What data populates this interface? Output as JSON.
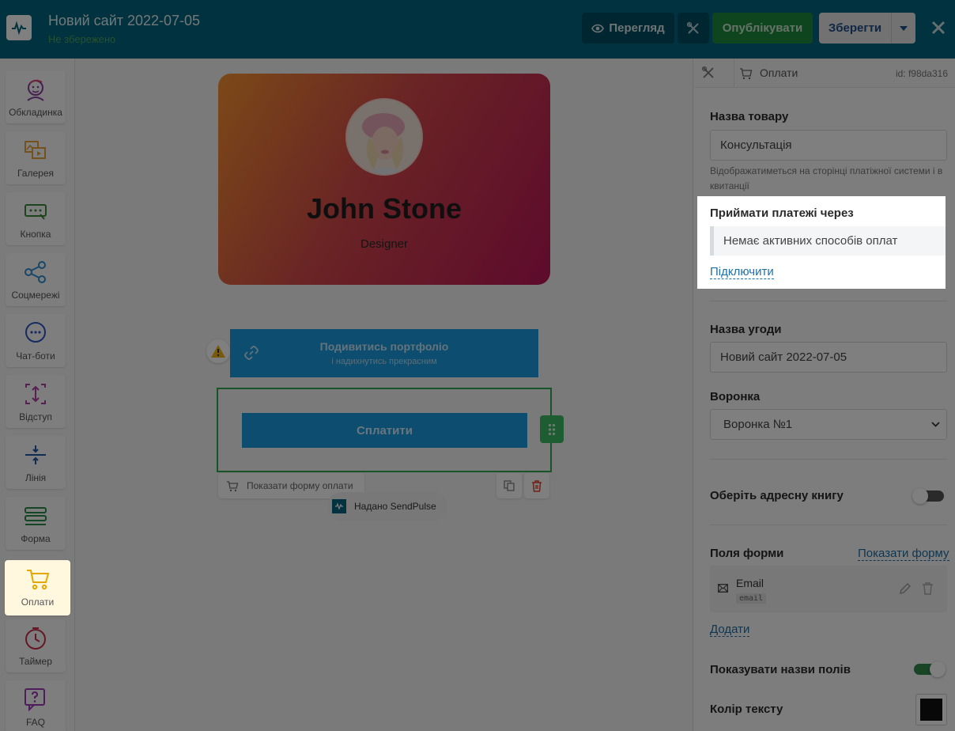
{
  "topbar": {
    "site_title": "Новий сайт 2022-07-05",
    "status": "Не збережено",
    "preview_label": "Перегляд",
    "publish_label": "Опублікувати",
    "save_label": "Зберегти"
  },
  "sidebar": {
    "items": [
      {
        "label": "Обкладинка",
        "icon": "avatar-icon"
      },
      {
        "label": "Галерея",
        "icon": "gallery-icon"
      },
      {
        "label": "Кнопка",
        "icon": "button-icon"
      },
      {
        "label": "Соцмережі",
        "icon": "share-icon"
      },
      {
        "label": "Чат-боти",
        "icon": "chat-icon"
      },
      {
        "label": "Відступ",
        "icon": "spacing-icon"
      },
      {
        "label": "Лінія",
        "icon": "line-icon"
      },
      {
        "label": "Форма",
        "icon": "form-icon"
      },
      {
        "label": "Оплати",
        "icon": "cart-icon"
      },
      {
        "label": "Таймер",
        "icon": "timer-icon"
      },
      {
        "label": "FAQ",
        "icon": "faq-icon"
      }
    ],
    "active": "Оплати"
  },
  "canvas": {
    "profile": {
      "name": "John Stone",
      "role": "Designer"
    },
    "portfolio_button": {
      "title": "Подивитись портфоліо",
      "subtitle": "і надихнутись прекрасним"
    },
    "pay_button": "Сплатити",
    "show_form": "Показати форму оплати",
    "powered_by": "Надано SendPulse"
  },
  "panel": {
    "breadcrumb": "Оплати",
    "block_id": "id: f98da316",
    "product_name_label": "Назва товару",
    "product_name_value": "Консультація",
    "product_hint": "Відображатиметься на сторінці платіжної системи і в квитанції",
    "accept_payments_label": "Приймати платежі через",
    "no_methods": "Немає активних способів оплат",
    "connect_link": "Підключити",
    "deal_name_label": "Назва угоди",
    "deal_name_value": "Новий сайт 2022-07-05",
    "funnel_label": "Воронка",
    "funnel_value": "Воронка №1",
    "address_book_label": "Оберіть адресну книгу",
    "address_book_on": false,
    "form_fields_label": "Поля форми",
    "show_form_link": "Показати форму",
    "field_name": "Email",
    "field_tag": "email",
    "add_link": "Додати",
    "show_field_names_label": "Показувати назви полів",
    "show_field_names_on": true,
    "text_color_label": "Колір тексту",
    "text_color": "#111111"
  },
  "colors": {
    "topbar": "#00657e",
    "publish": "#1e8a3c",
    "button_blue": "#1a9bdf",
    "selection_green": "#2fa84f"
  }
}
